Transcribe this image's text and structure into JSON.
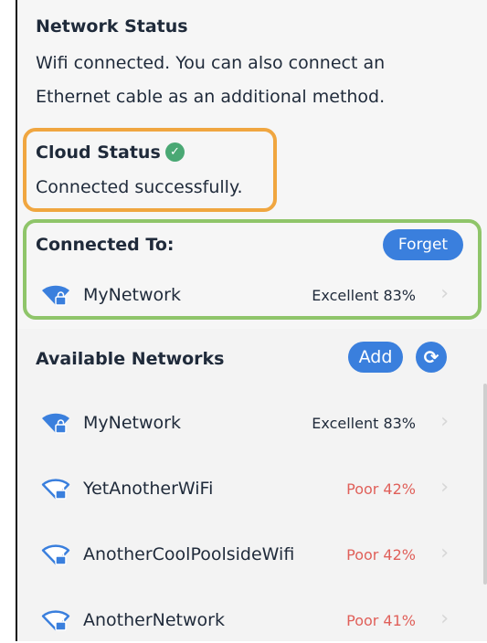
{
  "network_status": {
    "title": "Network Status",
    "line1": "Wifi connected.  You can also connect an",
    "line2": "Ethernet cable as an additional method."
  },
  "cloud_status": {
    "title": "Cloud Status",
    "icon": "check-circle-icon",
    "message": "Connected successfully."
  },
  "connected_to": {
    "title": "Connected To:",
    "forget_label": "Forget",
    "network": {
      "name": "MyNetwork",
      "quality": "Excellent 83%",
      "quality_color": "#1f2a3a",
      "icon": "wifi-locked-filled-icon"
    }
  },
  "available": {
    "title": "Available Networks",
    "add_label": "Add",
    "refresh_icon": "refresh-icon",
    "networks": [
      {
        "name": "MyNetwork",
        "quality": "Excellent 83%",
        "quality_color": "#1f2a3a",
        "icon": "wifi-locked-filled-icon"
      },
      {
        "name": "YetAnotherWiFi",
        "quality": "Poor 42%",
        "quality_color": "#e0605a",
        "icon": "wifi-locked-outline-icon"
      },
      {
        "name": "AnotherCoolPoolsideWifi",
        "quality": "Poor 42%",
        "quality_color": "#e0605a",
        "icon": "wifi-locked-outline-icon"
      },
      {
        "name": "AnotherNetwork",
        "quality": "Poor 41%",
        "quality_color": "#e0605a",
        "icon": "wifi-locked-outline-icon"
      }
    ]
  },
  "colors": {
    "accent_blue": "#3a7fdd",
    "cloud_highlight": "#f0a640",
    "connected_highlight": "#8fc56a",
    "poor": "#e0605a",
    "success": "#4aa874"
  }
}
